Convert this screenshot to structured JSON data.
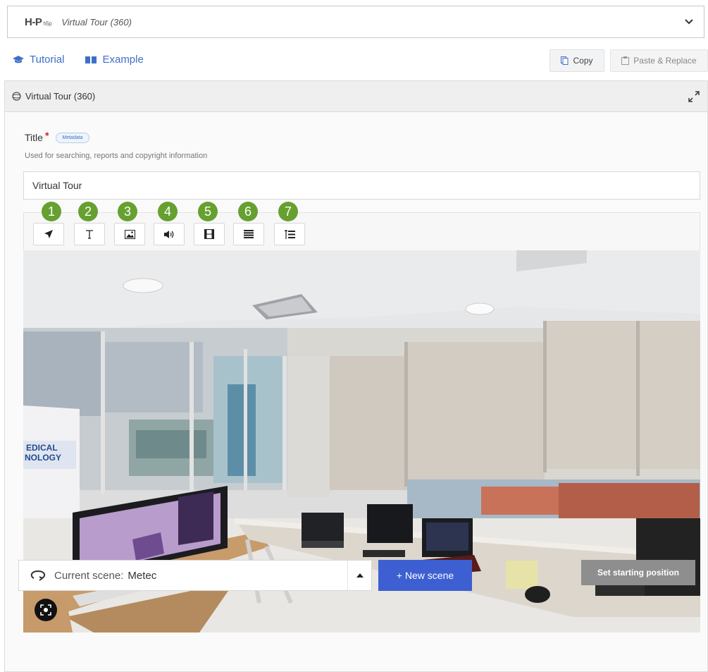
{
  "library": {
    "logo": "H-P",
    "logo_suffix": "h5p",
    "name": "Virtual Tour (360)"
  },
  "help": {
    "tutorial": "Tutorial",
    "example": "Example"
  },
  "clipboard": {
    "copy": "Copy",
    "paste": "Paste & Replace"
  },
  "panel": {
    "header": "Virtual Tour (360)"
  },
  "title_field": {
    "label": "Title",
    "required_mark": "*",
    "badge": "Metadata",
    "description": "Used for searching, reports and copyright information",
    "value": "Virtual Tour"
  },
  "toolbar": {
    "markers": [
      "1",
      "2",
      "3",
      "4",
      "5",
      "6",
      "7"
    ],
    "tools": [
      {
        "icon": "navigation-arrow-icon"
      },
      {
        "icon": "text-icon"
      },
      {
        "icon": "image-icon"
      },
      {
        "icon": "audio-icon"
      },
      {
        "icon": "video-icon"
      },
      {
        "icon": "summary-list-icon"
      },
      {
        "icon": "single-choice-list-icon"
      }
    ],
    "marker_color": "#66a030"
  },
  "navigation": {
    "current_scene_label": "Current scene:",
    "current_scene_value": "Metec",
    "new_scene": "+ New scene",
    "set_start": "Set starting position"
  },
  "colors": {
    "accent_blue": "#3d5fd1",
    "link_blue": "#3d6fc9",
    "disabled_gray": "#8e8e8e"
  }
}
